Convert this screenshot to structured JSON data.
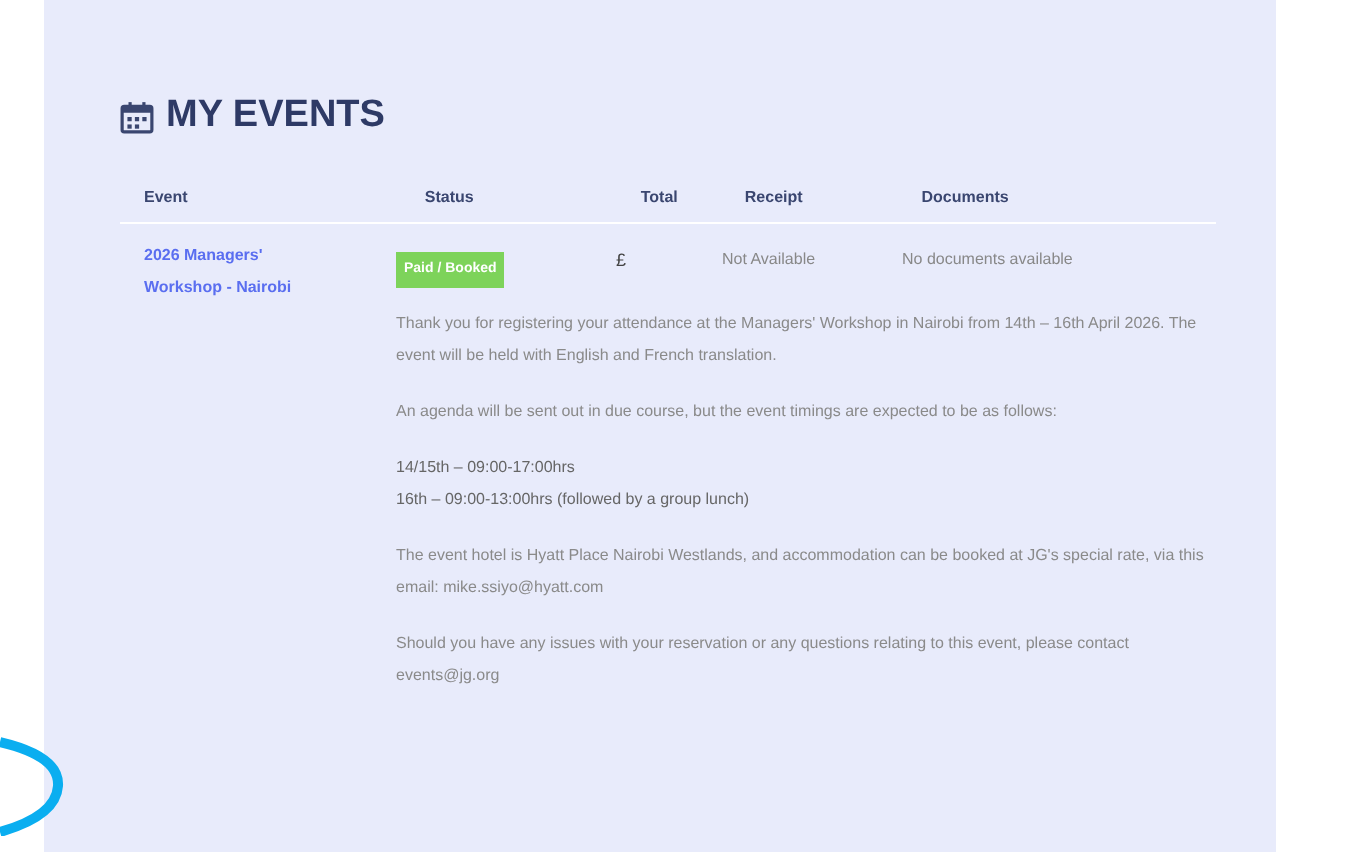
{
  "section": {
    "title": "MY EVENTS"
  },
  "table": {
    "columns": [
      "Event",
      "Status",
      "Total",
      "Receipt",
      "Documents"
    ],
    "rows": [
      {
        "event": "2026 Managers' Workshop - Nairobi",
        "status": "Paid / Booked",
        "total": "£",
        "receipt": "Not Available",
        "documents": "No documents available",
        "details": [
          "Thank you for registering your attendance at the Managers' Workshop in Nairobi from 14th – 16th April 2026. The event will be held with English and French translation.",
          "An agenda will be sent out in due course, but the event timings are expected to be as follows:",
          [
            "14/15th – 09:00-17:00hrs",
            "16th – 09:00-13:00hrs (followed by a group lunch)"
          ],
          "The event hotel is Hyatt Place Nairobi Westlands, and accommodation can be booked at JG's special rate, via this email: mike.ssiyo@hyatt.com",
          "Should you have any issues with your reservation or any questions relating to this event, please contact events@jg.org"
        ]
      }
    ]
  }
}
